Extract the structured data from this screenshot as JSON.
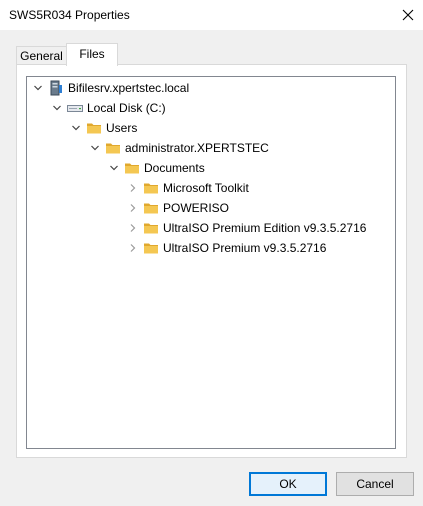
{
  "window": {
    "title": "SWS5R034 Properties",
    "close_glyph": "✕"
  },
  "tabs": [
    {
      "label": "General",
      "active": false
    },
    {
      "label": "Files",
      "active": true
    }
  ],
  "tree": {
    "nodes": [
      {
        "label": "Bifilesrv.xpertstec.local",
        "icon": "server-icon",
        "expander": "expanded"
      },
      {
        "label": "Local Disk (C:)",
        "icon": "drive-icon",
        "expander": "expanded"
      },
      {
        "label": "Users",
        "icon": "folder-icon",
        "expander": "expanded"
      },
      {
        "label": "administrator.XPERTSTEC",
        "icon": "folder-icon",
        "expander": "expanded"
      },
      {
        "label": "Documents",
        "icon": "folder-icon",
        "expander": "expanded"
      },
      {
        "label": "Microsoft Toolkit",
        "icon": "folder-icon",
        "expander": "collapsed"
      },
      {
        "label": "POWERISO",
        "icon": "folder-icon",
        "expander": "collapsed"
      },
      {
        "label": "UltraISO Premium Edition v9.3.5.2716",
        "icon": "folder-icon",
        "expander": "collapsed"
      },
      {
        "label": "UltraISO Premium v9.3.5.2716",
        "icon": "folder-icon",
        "expander": "collapsed"
      }
    ]
  },
  "buttons": {
    "ok_label": "OK",
    "cancel_label": "Cancel"
  },
  "colors": {
    "accent": "#0078d7",
    "folder": "#f4c752",
    "folder_dark": "#e0a82e"
  }
}
